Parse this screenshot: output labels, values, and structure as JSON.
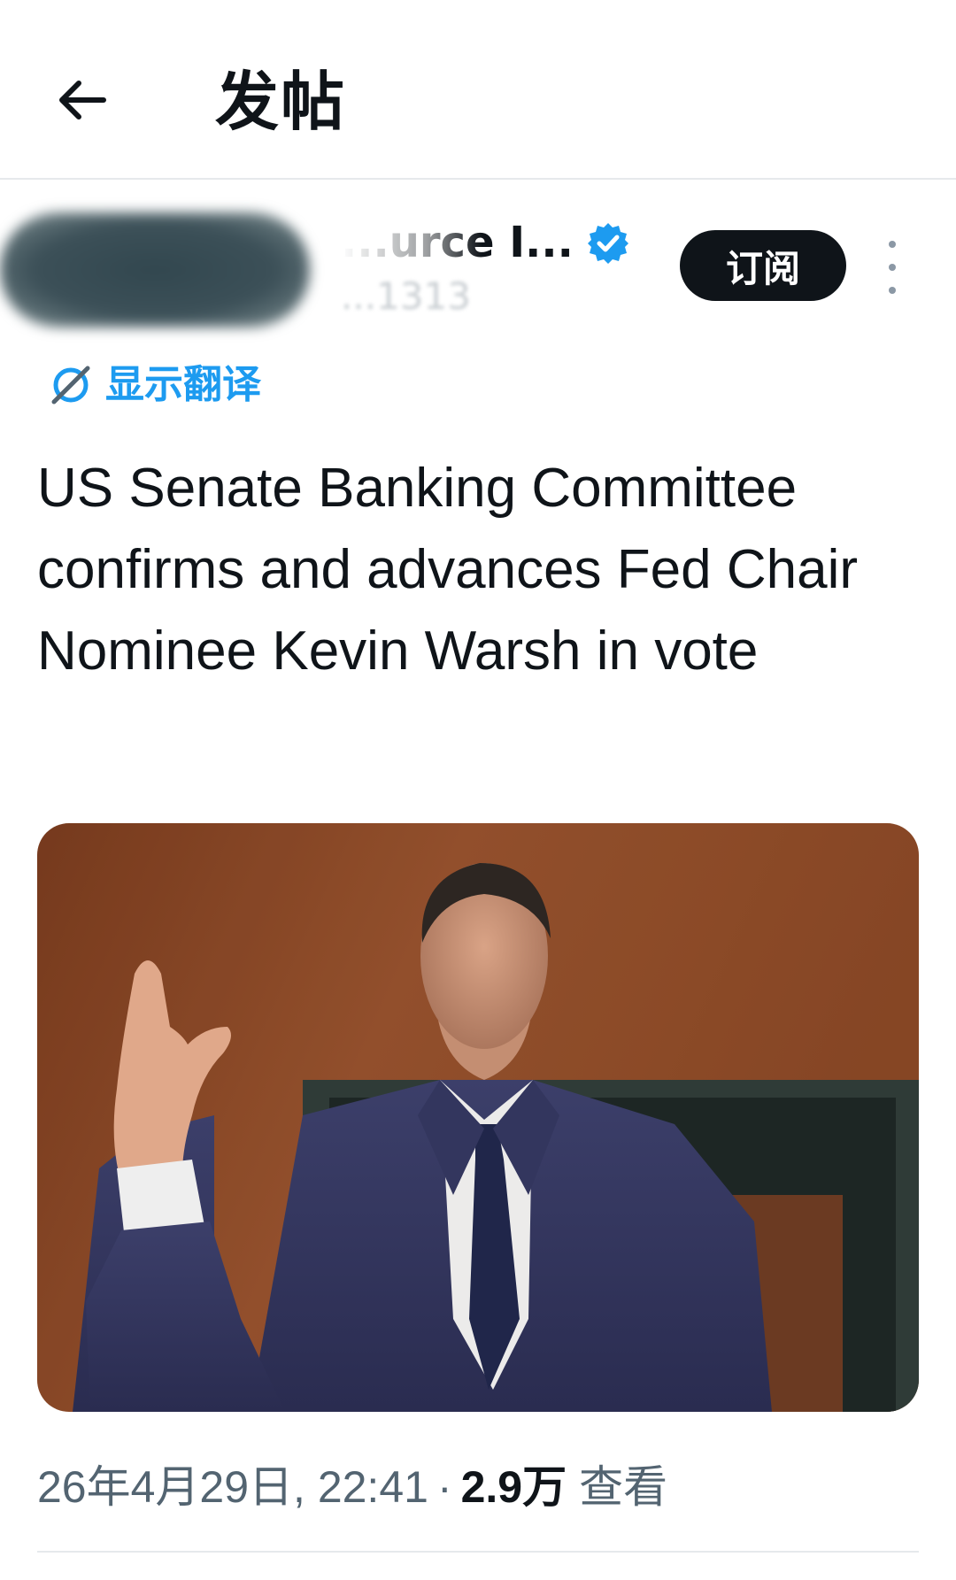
{
  "header": {
    "title": "发帖"
  },
  "author": {
    "name": "...urce I...",
    "handle": "...1313",
    "verified": true,
    "subscribe_label": "订阅"
  },
  "translate": {
    "label": "显示翻译"
  },
  "tweet": {
    "text": "US Senate Banking Committee confirms and advances Fed Chair Nominee Kevin Warsh in vote"
  },
  "meta": {
    "datetime": "26年4月29日, 22:41",
    "separator": "·",
    "views_count": "2.9万",
    "views_label": "查看"
  },
  "colors": {
    "accent": "#1d9bf0",
    "text_primary": "#0f1419",
    "text_secondary": "#536471"
  }
}
